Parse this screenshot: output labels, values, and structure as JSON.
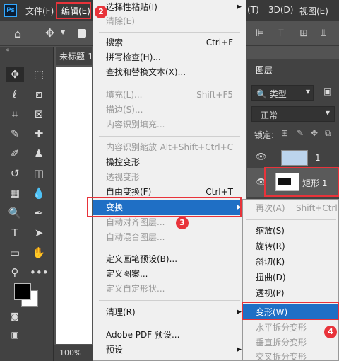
{
  "menubar": {
    "logo": "Ps",
    "file": "文件(F)",
    "edit": "编辑(E)",
    "type_partial": "(T)",
    "threed": "3D(D)",
    "view": "视图(E)"
  },
  "document": {
    "tab_title": "未标题-1",
    "zoom": "100%"
  },
  "layers_panel": {
    "title": "图层",
    "filter_label": "类型",
    "blend_mode": "正常",
    "lock_label": "锁定:",
    "layers": [
      {
        "name": "1"
      },
      {
        "name": "矩形 1"
      }
    ]
  },
  "edit_menu": {
    "items": [
      {
        "label": "选择性粘贴(I)",
        "shortcut": "",
        "disabled": false,
        "submenu": true
      },
      {
        "label": "清除(E)",
        "shortcut": "",
        "disabled": true
      },
      {
        "label": "搜索",
        "shortcut": "Ctrl+F",
        "disabled": false
      },
      {
        "label": "拼写检查(H)...",
        "shortcut": "",
        "disabled": false
      },
      {
        "label": "查找和替换文本(X)...",
        "shortcut": "",
        "disabled": false
      },
      {
        "label": "填充(L)...",
        "shortcut": "Shift+F5",
        "disabled": true
      },
      {
        "label": "描边(S)...",
        "shortcut": "",
        "disabled": true
      },
      {
        "label": "内容识别填充...",
        "shortcut": "",
        "disabled": true
      },
      {
        "label": "内容识别缩放",
        "shortcut": "Alt+Shift+Ctrl+C",
        "disabled": true
      },
      {
        "label": "操控变形",
        "shortcut": "",
        "disabled": false
      },
      {
        "label": "透视变形",
        "shortcut": "",
        "disabled": true
      },
      {
        "label": "自由变换(F)",
        "shortcut": "Ctrl+T",
        "disabled": false
      },
      {
        "label": "变换",
        "shortcut": "",
        "disabled": false,
        "submenu": true,
        "highlighted": true
      },
      {
        "label": "自动对齐图层...",
        "shortcut": "",
        "disabled": true
      },
      {
        "label": "自动混合图层...",
        "shortcut": "",
        "disabled": true
      },
      {
        "label": "定义画笔预设(B)...",
        "shortcut": "",
        "disabled": false
      },
      {
        "label": "定义图案...",
        "shortcut": "",
        "disabled": false
      },
      {
        "label": "定义自定形状...",
        "shortcut": "",
        "disabled": true
      },
      {
        "label": "清理(R)",
        "shortcut": "",
        "disabled": false,
        "submenu": true
      },
      {
        "label": "Adobe PDF 预设...",
        "shortcut": "",
        "disabled": false
      },
      {
        "label": "预设",
        "shortcut": "",
        "disabled": false,
        "submenu": true
      }
    ]
  },
  "transform_submenu": {
    "items": [
      {
        "label": "再次(A)",
        "shortcut": "Shift+Ctrl+",
        "disabled": true
      },
      {
        "label": "缩放(S)",
        "shortcut": "",
        "disabled": false
      },
      {
        "label": "旋转(R)",
        "shortcut": "",
        "disabled": false
      },
      {
        "label": "斜切(K)",
        "shortcut": "",
        "disabled": false
      },
      {
        "label": "扭曲(D)",
        "shortcut": "",
        "disabled": false
      },
      {
        "label": "透视(P)",
        "shortcut": "",
        "disabled": false
      },
      {
        "label": "变形(W)",
        "shortcut": "",
        "disabled": false,
        "highlighted": true
      },
      {
        "label": "水平拆分变形",
        "shortcut": "",
        "disabled": true
      },
      {
        "label": "垂直拆分变形",
        "shortcut": "",
        "disabled": true
      },
      {
        "label": "交叉拆分变形",
        "shortcut": "",
        "disabled": true
      }
    ]
  },
  "annotations": {
    "step2": "2",
    "step3": "3",
    "step4": "4"
  },
  "colors": {
    "highlight": "#1f6fc5",
    "annotation_red": "#e8333a",
    "menu_bg": "#f0f0f0",
    "app_dark": "#424242"
  }
}
